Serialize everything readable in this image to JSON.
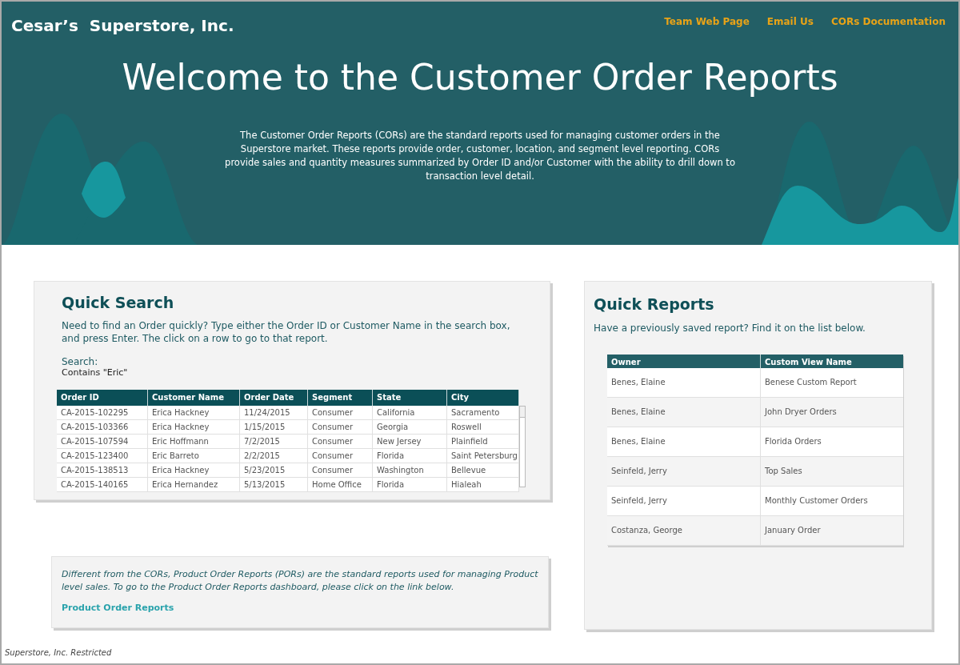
{
  "header": {
    "brand": "Cesar’s  Superstore, Inc.",
    "links": [
      "Team Web Page",
      "Email Us",
      "CORs Documentation"
    ],
    "title": "Welcome to the Customer Order Reports",
    "intro": "The Customer Order Reports (CORs) are the standard reports used for managing customer orders in the Superstore market. These reports provide order, customer, location, and segment level reporting. CORs provide sales and quantity measures summarized by Order ID and/or Customer with the ability to drill down to transaction level detail."
  },
  "quick_search": {
    "title": "Quick Search",
    "description": "Need to find an Order quickly? Type either the Order ID or Customer Name in the search box, and press Enter. The click on a row to go to that report.",
    "search_label": "Search:",
    "search_value": "Contains \"Eric\"",
    "table": {
      "columns": [
        "Order ID",
        "Customer Name",
        "Order Date",
        "Segment",
        "State",
        "City"
      ],
      "rows": [
        [
          "CA-2015-102295",
          "Erica Hackney",
          "11/24/2015",
          "Consumer",
          "California",
          "Sacramento"
        ],
        [
          "CA-2015-103366",
          "Erica Hackney",
          "1/15/2015",
          "Consumer",
          "Georgia",
          "Roswell"
        ],
        [
          "CA-2015-107594",
          "Eric Hoffmann",
          "7/2/2015",
          "Consumer",
          "New Jersey",
          "Plainfield"
        ],
        [
          "CA-2015-123400",
          "Eric Barreto",
          "2/2/2015",
          "Consumer",
          "Florida",
          "Saint Petersburg"
        ],
        [
          "CA-2015-138513",
          "Erica Hackney",
          "5/23/2015",
          "Consumer",
          "Washington",
          "Bellevue"
        ],
        [
          "CA-2015-140165",
          "Erica Hernandez",
          "5/13/2015",
          "Home Office",
          "Florida",
          "Hialeah"
        ]
      ]
    }
  },
  "product_note": {
    "text": "Different from the CORs, Product Order Reports (PORs) are the standard reports used for managing Product level sales.  To go to the Product Order Reports dashboard, please click on the link below.",
    "link": "Product Order Reports"
  },
  "quick_reports": {
    "title": "Quick Reports",
    "description": "Have a previously saved report? Find it on the list below.",
    "table": {
      "columns": [
        "Owner",
        "Custom View Name"
      ],
      "rows": [
        [
          "Benes, Elaine",
          "Benese Custom Report"
        ],
        [
          "Benes, Elaine",
          "John Dryer Orders"
        ],
        [
          "Benes, Elaine",
          "Florida Orders"
        ],
        [
          "Seinfeld, Jerry",
          "Top Sales"
        ],
        [
          "Seinfeld, Jerry",
          "Monthly Customer Orders"
        ],
        [
          "Costanza, George",
          "January Order"
        ]
      ]
    }
  },
  "footer": "Superstore, Inc. Restricted"
}
